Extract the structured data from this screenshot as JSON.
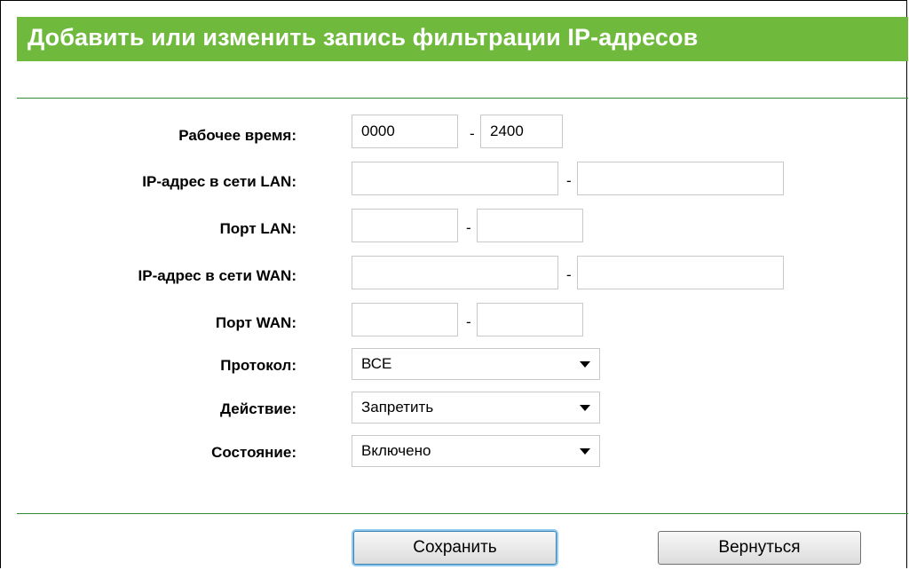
{
  "title": "Добавить или изменить запись фильтрации IP-адресов",
  "fields": {
    "work_time": {
      "label": "Рабочее время:",
      "start": "0000",
      "end": "2400"
    },
    "lan_ip": {
      "label": "IP-адрес в сети LAN:",
      "start": "",
      "end": ""
    },
    "lan_port": {
      "label": "Порт LAN:",
      "start": "",
      "end": ""
    },
    "wan_ip": {
      "label": "IP-адрес в сети WAN:",
      "start": "",
      "end": ""
    },
    "wan_port": {
      "label": "Порт WAN:",
      "start": "",
      "end": ""
    },
    "protocol": {
      "label": "Протокол:",
      "value": "ВСЕ"
    },
    "action": {
      "label": "Действие:",
      "value": "Запретить"
    },
    "status": {
      "label": "Состояние:",
      "value": "Включено"
    }
  },
  "separator": "-",
  "buttons": {
    "save": "Сохранить",
    "back": "Вернуться"
  },
  "colors": {
    "title_bar": "#6fba3c",
    "divider": "#2e8b3a"
  },
  "icons": {
    "dropdown": "chevron-down-icon"
  }
}
